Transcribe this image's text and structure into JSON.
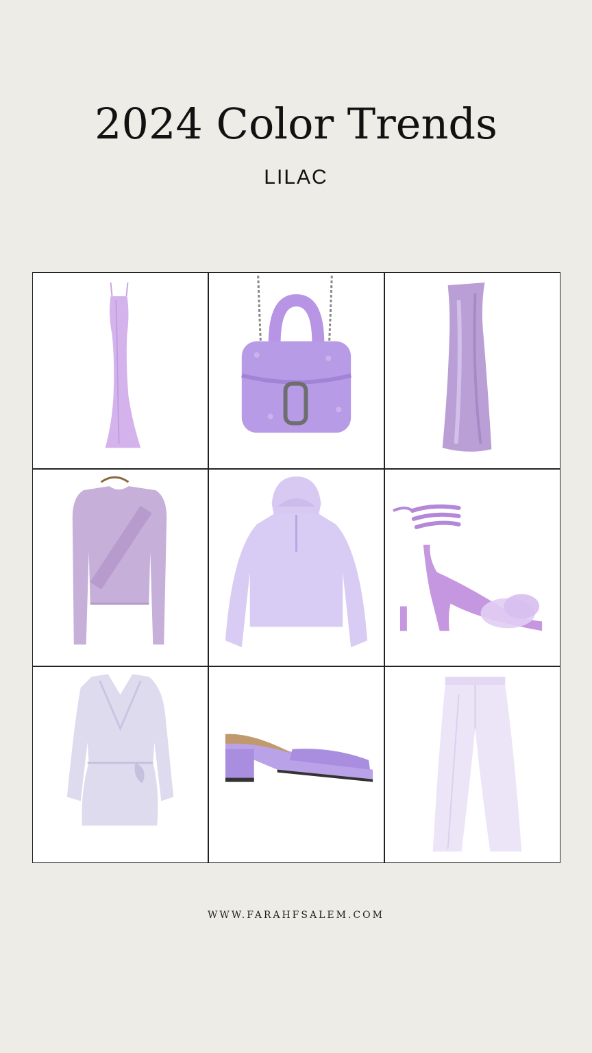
{
  "header": {
    "title": "2024 Color Trends",
    "subtitle": "LILAC"
  },
  "palette": {
    "background": "#edece6",
    "lilac": "#c8a6e0",
    "lilac_light": "#ddc9ef",
    "lilac_dark": "#a985c8",
    "text": "#111111"
  },
  "products": [
    {
      "name": "slip-dress-icon"
    },
    {
      "name": "furry-handbag-icon"
    },
    {
      "name": "satin-maxi-dress-icon"
    },
    {
      "name": "knit-sweater-icon"
    },
    {
      "name": "half-zip-hoodie-icon"
    },
    {
      "name": "lace-up-heeled-sandal-icon"
    },
    {
      "name": "wrap-mini-dress-icon"
    },
    {
      "name": "block-heel-mule-icon"
    },
    {
      "name": "wide-leg-trousers-icon"
    }
  ],
  "footer": {
    "url": "WWW.FARAHFSALEM.COM"
  }
}
